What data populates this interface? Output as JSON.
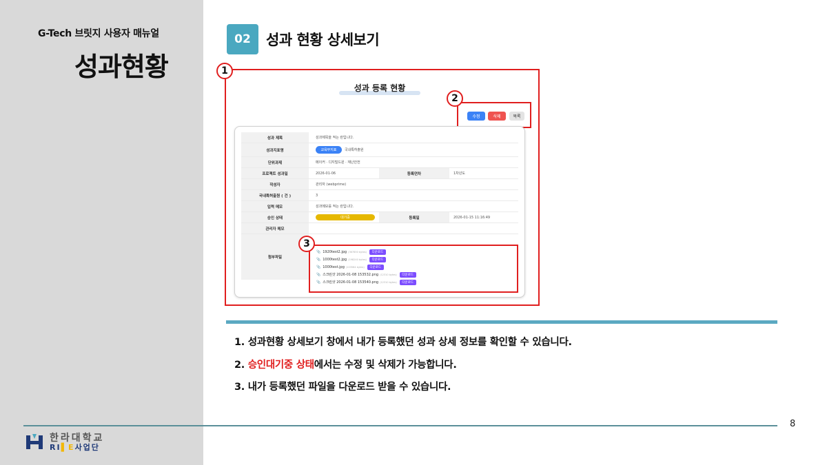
{
  "sidebar": {
    "manual_title": "G-Tech 브릿지 사용자 매뉴얼",
    "page_title": "성과현황"
  },
  "section": {
    "number": "02",
    "title": "성과 현황 상세보기"
  },
  "markers": [
    "1",
    "2",
    "3"
  ],
  "mock": {
    "title": "성과 등록 현황",
    "buttons": {
      "edit": "수정",
      "delete": "삭제",
      "list": "목록"
    },
    "rows": [
      {
        "label": "성과 제목",
        "value": "성과제목을 적는 란입니다."
      },
      {
        "label": "성과지표명",
        "badge": "교육부지표",
        "value": "국내특허출원"
      },
      {
        "label": "단위과제",
        "value": "메이커 · 디지털드윈 · 재난안전"
      },
      {
        "label": "프로젝트 성과일",
        "value": "2026-01-06",
        "label2": "등록연차",
        "value2": "1차년도"
      },
      {
        "label": "작성자",
        "value": "관리자 (webprime)"
      },
      {
        "label": "국내특허출원 ( 건 )",
        "value": "3"
      },
      {
        "label": "입력 메모",
        "value": "성과메모를 적는 란입니다."
      },
      {
        "label": "승인 상태",
        "status": "대기중",
        "label2": "등록일",
        "value2": "2026-01-15 11:16:49"
      },
      {
        "label": "관리자 메모",
        "value": ""
      }
    ],
    "files_label": "첨부파일",
    "download_label": "다운로드",
    "files": [
      {
        "name": "1920test2.jpg",
        "size": "(367850 bytes)"
      },
      {
        "name": "1000test2.jpg",
        "size": "(198240 bytes)"
      },
      {
        "name": "1000test.jpg",
        "size": "(103584 bytes)"
      },
      {
        "name": "스크린샷 2026-01-08 153532.png",
        "size": "(12310 bytes)"
      },
      {
        "name": "스크린샷 2026-01-08 153540.png",
        "size": "(12310 bytes)"
      }
    ]
  },
  "notes": {
    "n1": "1. 성과현황 상세보기 창에서 내가 등록했던 성과 상세 정보를 확인할 수 있습니다.",
    "n2_prefix": "2. ",
    "n2_highlight": "승인대기중 상태",
    "n2_suffix": "에서는 수정 및 삭제가 가능합니다.",
    "n3": "3. 내가 등록했던 파일을 다운로드 받을 수 있습니다."
  },
  "footer": {
    "logo_name": "한라대학교",
    "logo_sub_a": "RI",
    "logo_sub_b": "E",
    "logo_sub_c": "사업단",
    "page_number": "8"
  },
  "colors": {
    "accent": "#4aa8c0",
    "highlight": "#e01e1e",
    "sidebar": "#d9d9d9"
  }
}
